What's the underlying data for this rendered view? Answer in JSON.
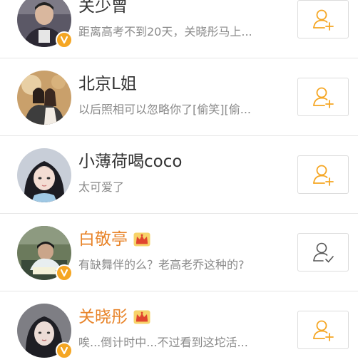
{
  "users": [
    {
      "name": "关少曾",
      "description": "距离高考不到20天，关晓彤马上...",
      "verified": true,
      "vip": false,
      "followed": false
    },
    {
      "name": "北京L姐",
      "description": "以后照相可以忽略你了[偷笑][偷...",
      "verified": false,
      "vip": false,
      "followed": false
    },
    {
      "name": "小薄荷喝coco",
      "description": "太可爱了",
      "verified": false,
      "vip": false,
      "followed": false
    },
    {
      "name": "白敬亭",
      "description": "有缺舞伴的么？老高老乔这种的?",
      "verified": true,
      "vip": true,
      "followed": true
    },
    {
      "name": "关晓彤",
      "description": "唉...倒计时中...不过看到这坨活...",
      "verified": true,
      "vip": true,
      "followed": false
    }
  ],
  "colors": {
    "accent": "#f5a623",
    "vip_name": "#e8842a",
    "name": "#333333",
    "description": "#8a8a8a",
    "followed_icon": "#555555"
  },
  "icons": {
    "follow": "add-user-icon",
    "followed": "user-check-icon",
    "verified": "verified-v-icon",
    "vip": "crown-icon"
  }
}
